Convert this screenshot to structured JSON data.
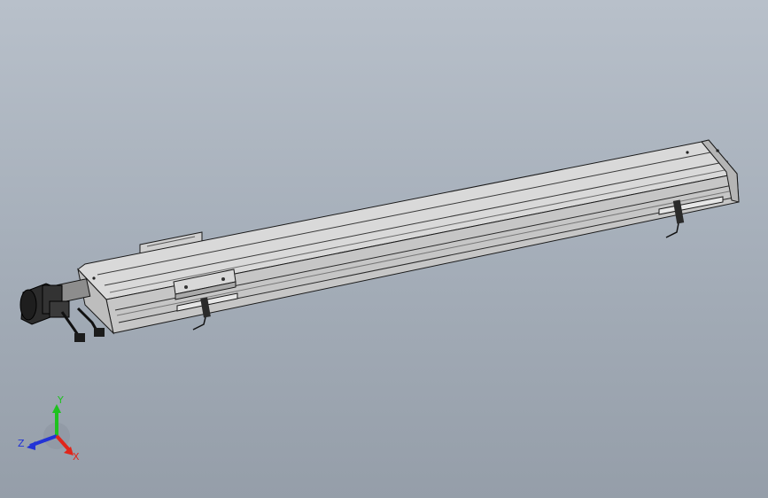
{
  "viewport": {
    "background_top": "#b8c0ca",
    "background_bottom": "#959ea9"
  },
  "model": {
    "part": "linear-actuator-module",
    "body_color": "#d2d2d2",
    "edge_color": "#1a1a1a",
    "motor_color": "#2c2c2c"
  },
  "triad": {
    "x_label": "X",
    "y_label": "Y",
    "z_label": "Z",
    "x_color": "#e0261b",
    "y_color": "#1ec21e",
    "z_color": "#2233d6"
  }
}
